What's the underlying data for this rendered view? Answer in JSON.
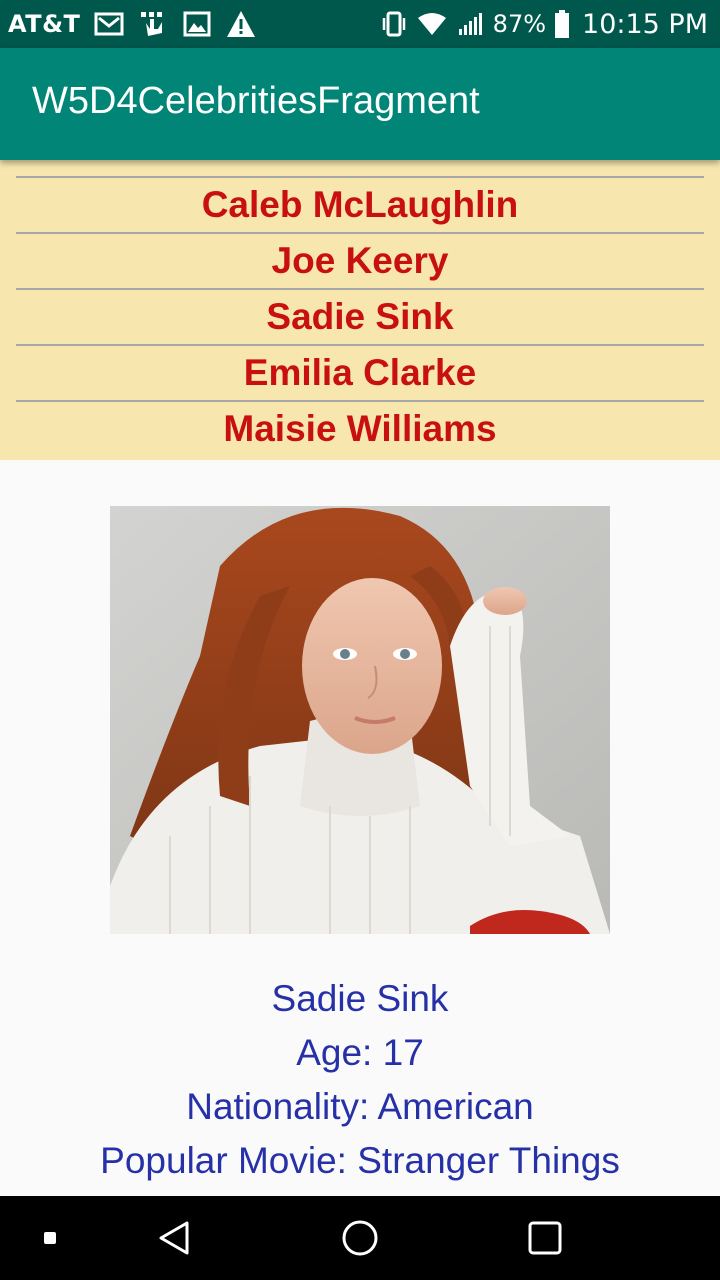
{
  "status_bar": {
    "carrier": "AT&T",
    "battery_percent": "87%",
    "time": "10:15 PM",
    "icons": [
      "gmail-icon",
      "usb-debug-icon",
      "image-icon",
      "warning-icon",
      "vibrate-icon",
      "wifi-icon",
      "signal-icon",
      "battery-icon"
    ]
  },
  "app_bar": {
    "title": "W5D4CelebritiesFragment",
    "color": "#008577"
  },
  "celebrity_list": {
    "background": "#f7e7ae",
    "text_color": "#c8100e",
    "items": [
      {
        "label": "Caleb McLaughlin"
      },
      {
        "label": "Joe Keery"
      },
      {
        "label": "Sadie Sink"
      },
      {
        "label": "Emilia Clarke"
      },
      {
        "label": "Maisie Williams"
      }
    ]
  },
  "detail": {
    "text_color": "#2631a7",
    "name": "Sadie Sink",
    "age": "Age: 17",
    "nationality": "Nationality: American",
    "popular_movie": "Popular Movie: Stranger Things"
  },
  "nav_bar": {
    "buttons": [
      "recent-square-small-icon",
      "back-icon",
      "home-icon",
      "overview-icon"
    ]
  }
}
